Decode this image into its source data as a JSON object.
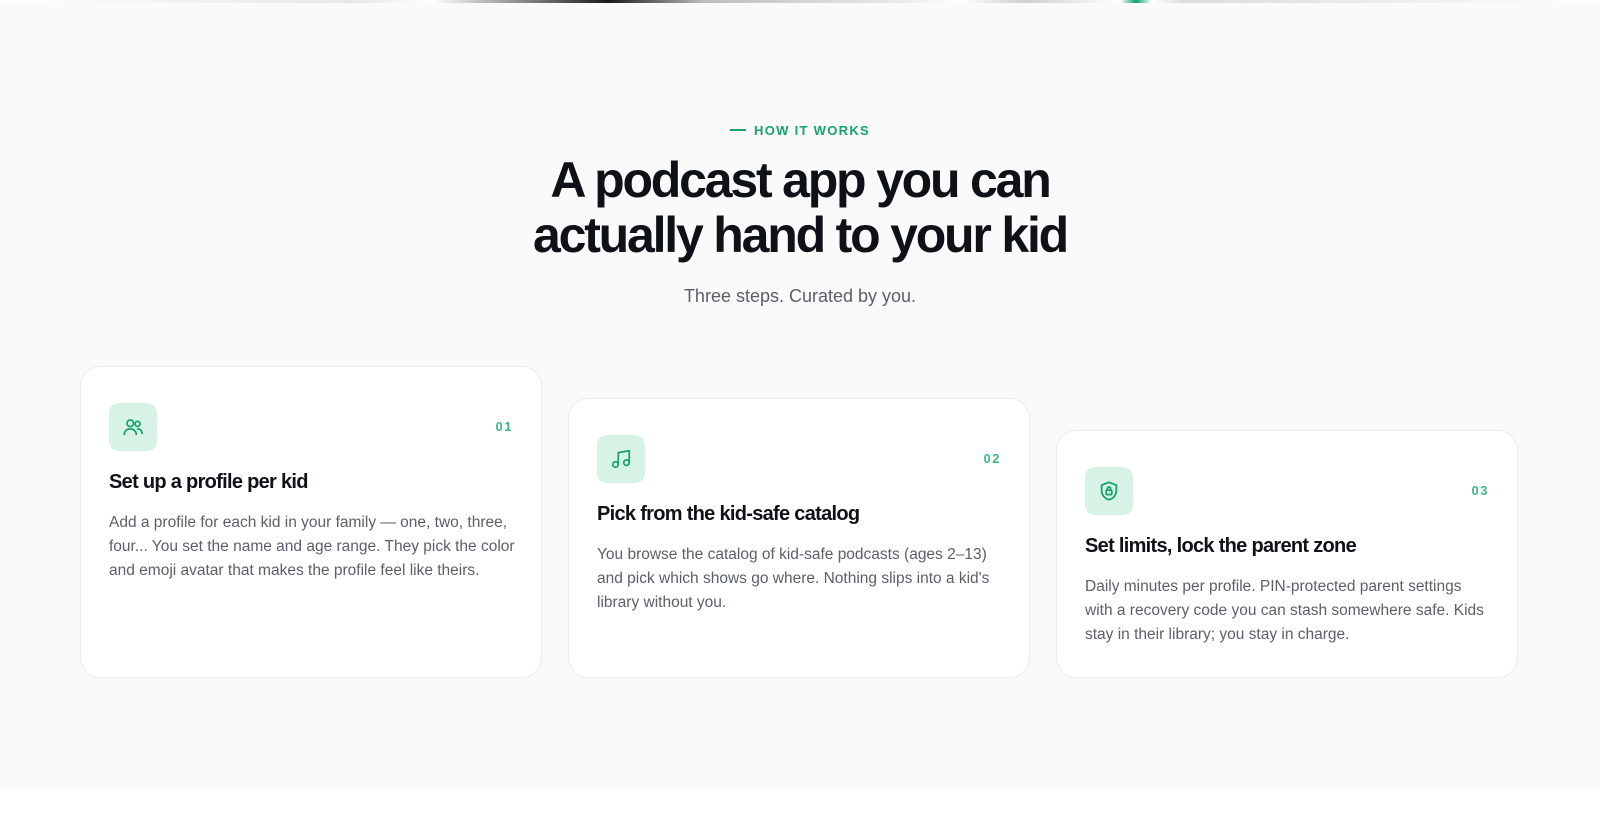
{
  "section": {
    "eyebrow": "HOW IT WORKS",
    "title_line1": "A podcast app you can",
    "title_line2": "actually hand to your kid",
    "subtitle": "Three steps. Curated by you."
  },
  "colors": {
    "accent": "#16a36b",
    "icon_tile": "#d6f3e5",
    "heading": "#0e1116",
    "body_text": "#5b6068",
    "section_bg": "#fafafa"
  },
  "steps": [
    {
      "number": "01",
      "icon": "users-icon",
      "title": "Set up a profile per kid",
      "body": "Add a profile for each kid in your family — one, two, three, four... You set the name and age range. They pick the color and emoji avatar that makes the profile feel like theirs."
    },
    {
      "number": "02",
      "icon": "music-note-icon",
      "title": "Pick from the kid-safe catalog",
      "body": "You browse the catalog of kid-safe podcasts (ages 2–13) and pick which shows go where. Nothing slips into a kid's library without you."
    },
    {
      "number": "03",
      "icon": "shield-lock-icon",
      "title": "Set limits, lock the parent zone",
      "body": "Daily minutes per profile. PIN-protected parent settings with a recovery code you can stash somewhere safe. Kids stay in their library; you stay in charge."
    }
  ]
}
